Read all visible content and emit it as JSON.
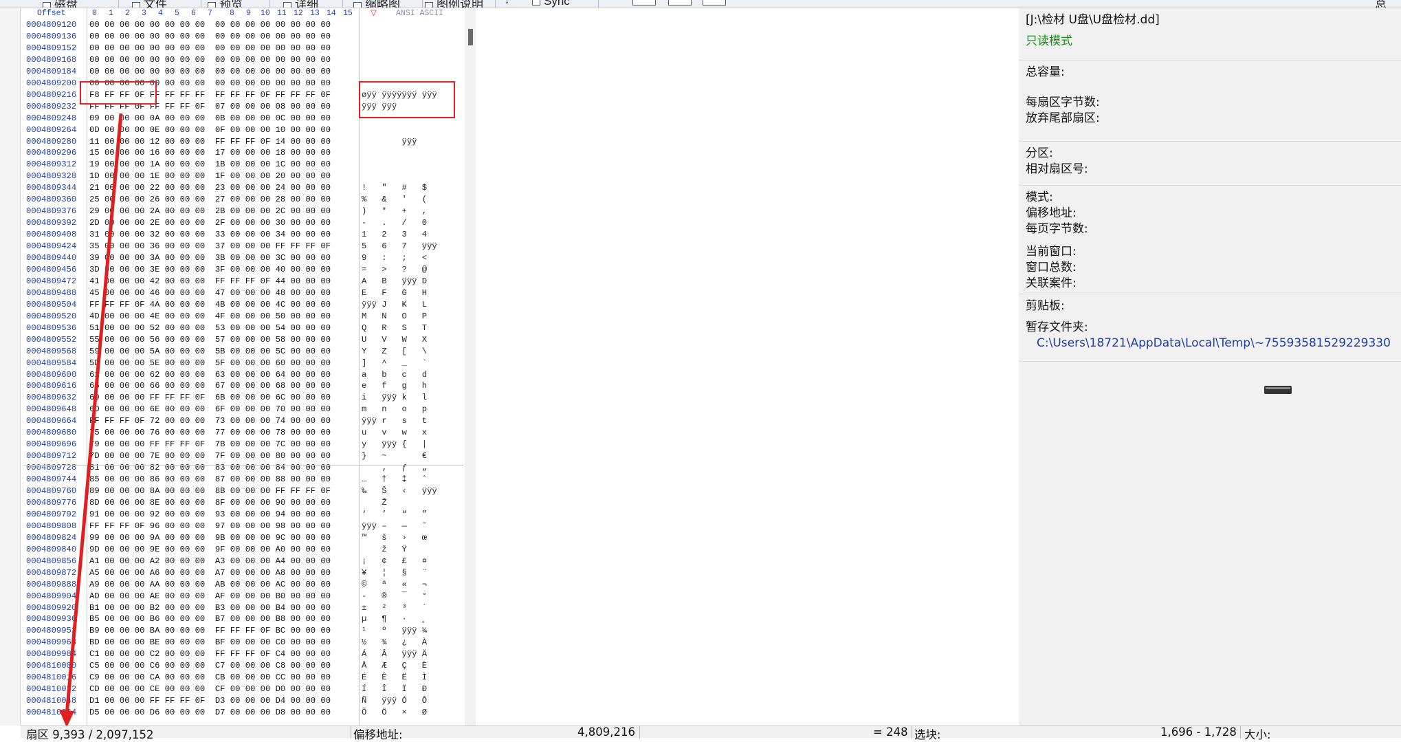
{
  "toolbar": {
    "items": [
      {
        "label": "磁盘",
        "icon": "disk-icon"
      },
      {
        "label": "文件",
        "icon": "file-icon"
      },
      {
        "label": "预览",
        "icon": "preview-icon"
      },
      {
        "label": "详细",
        "icon": "details-icon"
      },
      {
        "label": "缩略图",
        "icon": "thumbnail-icon"
      },
      {
        "label": "图例说明",
        "icon": "legend-icon"
      },
      {
        "label": "Sync",
        "icon": "sync-icon"
      }
    ],
    "right_label": "总"
  },
  "hex_view": {
    "header": {
      "offset_label": "Offset",
      "columns": [
        "0",
        "1",
        "2",
        "3",
        "4",
        "5",
        "6",
        "7",
        "8",
        "9",
        "10",
        "11",
        "12",
        "13",
        "14",
        "15"
      ],
      "ascii_label": "ANSI ASCII"
    },
    "rows": [
      {
        "off": "0004809120",
        "bytes": "00 00 00 00 00 00 00 00  00 00 00 00 00 00 00 00",
        "ascii": ""
      },
      {
        "off": "0004809136",
        "bytes": "00 00 00 00 00 00 00 00  00 00 00 00 00 00 00 00",
        "ascii": ""
      },
      {
        "off": "0004809152",
        "bytes": "00 00 00 00 00 00 00 00  00 00 00 00 00 00 00 00",
        "ascii": ""
      },
      {
        "off": "0004809168",
        "bytes": "00 00 00 00 00 00 00 00  00 00 00 00 00 00 00 00",
        "ascii": ""
      },
      {
        "off": "0004809184",
        "bytes": "00 00 00 00 00 00 00 00  00 00 00 00 00 00 00 00",
        "ascii": ""
      },
      {
        "off": "0004809200",
        "bytes": "00 00 00 00 00 00 00 00  00 00 00 00 00 00 00 00",
        "ascii": ""
      },
      {
        "off": "0004809216",
        "bytes": "F8 FF FF 0F FF FF FF FF  FF FF FF 0F FF FF FF 0F",
        "ascii": "øÿÿ ÿÿÿÿÿÿÿ ÿÿÿ"
      },
      {
        "off": "0004809232",
        "bytes": "FF FF FF 0F FF FF FF 0F  07 00 00 00 08 00 00 00",
        "ascii": "ÿÿÿ ÿÿÿ"
      },
      {
        "off": "0004809248",
        "bytes": "09 00 00 00 0A 00 00 00  0B 00 00 00 0C 00 00 00",
        "ascii": ""
      },
      {
        "off": "0004809264",
        "bytes": "0D 00 00 00 0E 00 00 00  0F 00 00 00 10 00 00 00",
        "ascii": ""
      },
      {
        "off": "0004809280",
        "bytes": "11 00 00 00 12 00 00 00  FF FF FF 0F 14 00 00 00",
        "ascii": "        ÿÿÿ"
      },
      {
        "off": "0004809296",
        "bytes": "15 00 00 00 16 00 00 00  17 00 00 00 18 00 00 00",
        "ascii": ""
      },
      {
        "off": "0004809312",
        "bytes": "19 00 00 00 1A 00 00 00  1B 00 00 00 1C 00 00 00",
        "ascii": ""
      },
      {
        "off": "0004809328",
        "bytes": "1D 00 00 00 1E 00 00 00  1F 00 00 00 20 00 00 00",
        "ascii": ""
      },
      {
        "off": "0004809344",
        "bytes": "21 00 00 00 22 00 00 00  23 00 00 00 24 00 00 00",
        "ascii": "!   \"   #   $"
      },
      {
        "off": "0004809360",
        "bytes": "25 00 00 00 26 00 00 00  27 00 00 00 28 00 00 00",
        "ascii": "%   &   '   ("
      },
      {
        "off": "0004809376",
        "bytes": "29 00 00 00 2A 00 00 00  2B 00 00 00 2C 00 00 00",
        "ascii": ")   *   +   ,"
      },
      {
        "off": "0004809392",
        "bytes": "2D 00 00 00 2E 00 00 00  2F 00 00 00 30 00 00 00",
        "ascii": "-   .   /   0"
      },
      {
        "off": "0004809408",
        "bytes": "31 00 00 00 32 00 00 00  33 00 00 00 34 00 00 00",
        "ascii": "1   2   3   4"
      },
      {
        "off": "0004809424",
        "bytes": "35 00 00 00 36 00 00 00  37 00 00 00 FF FF FF 0F",
        "ascii": "5   6   7   ÿÿÿ"
      },
      {
        "off": "0004809440",
        "bytes": "39 00 00 00 3A 00 00 00  3B 00 00 00 3C 00 00 00",
        "ascii": "9   :   ;   <"
      },
      {
        "off": "0004809456",
        "bytes": "3D 00 00 00 3E 00 00 00  3F 00 00 00 40 00 00 00",
        "ascii": "=   >   ?   @"
      },
      {
        "off": "0004809472",
        "bytes": "41 00 00 00 42 00 00 00  FF FF FF 0F 44 00 00 00",
        "ascii": "A   B   ÿÿÿ D"
      },
      {
        "off": "0004809488",
        "bytes": "45 00 00 00 46 00 00 00  47 00 00 00 48 00 00 00",
        "ascii": "E   F   G   H"
      },
      {
        "off": "0004809504",
        "bytes": "FF FF FF 0F 4A 00 00 00  4B 00 00 00 4C 00 00 00",
        "ascii": "ÿÿÿ J   K   L"
      },
      {
        "off": "0004809520",
        "bytes": "4D 00 00 00 4E 00 00 00  4F 00 00 00 50 00 00 00",
        "ascii": "M   N   O   P"
      },
      {
        "off": "0004809536",
        "bytes": "51 00 00 00 52 00 00 00  53 00 00 00 54 00 00 00",
        "ascii": "Q   R   S   T"
      },
      {
        "off": "0004809552",
        "bytes": "55 00 00 00 56 00 00 00  57 00 00 00 58 00 00 00",
        "ascii": "U   V   W   X"
      },
      {
        "off": "0004809568",
        "bytes": "59 00 00 00 5A 00 00 00  5B 00 00 00 5C 00 00 00",
        "ascii": "Y   Z   [   \\"
      },
      {
        "off": "0004809584",
        "bytes": "5D 00 00 00 5E 00 00 00  5F 00 00 00 60 00 00 00",
        "ascii": "]   ^   _   `"
      },
      {
        "off": "0004809600",
        "bytes": "61 00 00 00 62 00 00 00  63 00 00 00 64 00 00 00",
        "ascii": "a   b   c   d"
      },
      {
        "off": "0004809616",
        "bytes": "65 00 00 00 66 00 00 00  67 00 00 00 68 00 00 00",
        "ascii": "e   f   g   h"
      },
      {
        "off": "0004809632",
        "bytes": "69 00 00 00 FF FF FF 0F  6B 00 00 00 6C 00 00 00",
        "ascii": "i   ÿÿÿ k   l"
      },
      {
        "off": "0004809648",
        "bytes": "6D 00 00 00 6E 00 00 00  6F 00 00 00 70 00 00 00",
        "ascii": "m   n   o   p"
      },
      {
        "off": "0004809664",
        "bytes": "FF FF FF 0F 72 00 00 00  73 00 00 00 74 00 00 00",
        "ascii": "ÿÿÿ r   s   t"
      },
      {
        "off": "0004809680",
        "bytes": "75 00 00 00 76 00 00 00  77 00 00 00 78 00 00 00",
        "ascii": "u   v   w   x"
      },
      {
        "off": "0004809696",
        "bytes": "79 00 00 00 FF FF FF 0F  7B 00 00 00 7C 00 00 00",
        "ascii": "y   ÿÿÿ {   |"
      },
      {
        "off": "0004809712",
        "bytes": "7D 00 00 00 7E 00 00 00  7F 00 00 00 80 00 00 00",
        "ascii": "}   ~       €"
      },
      {
        "off": "0004809728",
        "bytes": "81 00 00 00 82 00 00 00  83 00 00 00 84 00 00 00",
        "ascii": "    ‚   ƒ   „"
      },
      {
        "off": "0004809744",
        "bytes": "85 00 00 00 86 00 00 00  87 00 00 00 88 00 00 00",
        "ascii": "…   †   ‡   ˆ"
      },
      {
        "off": "0004809760",
        "bytes": "89 00 00 00 8A 00 00 00  8B 00 00 00 FF FF FF 0F",
        "ascii": "‰   Š   ‹   ÿÿÿ"
      },
      {
        "off": "0004809776",
        "bytes": "8D 00 00 00 8E 00 00 00  8F 00 00 00 90 00 00 00",
        "ascii": "    Ž"
      },
      {
        "off": "0004809792",
        "bytes": "91 00 00 00 92 00 00 00  93 00 00 00 94 00 00 00",
        "ascii": "‘   ’   “   ”"
      },
      {
        "off": "0004809808",
        "bytes": "FF FF FF 0F 96 00 00 00  97 00 00 00 98 00 00 00",
        "ascii": "ÿÿÿ –   —   ˜"
      },
      {
        "off": "0004809824",
        "bytes": "99 00 00 00 9A 00 00 00  9B 00 00 00 9C 00 00 00",
        "ascii": "™   š   ›   œ"
      },
      {
        "off": "0004809840",
        "bytes": "9D 00 00 00 9E 00 00 00  9F 00 00 00 A0 00 00 00",
        "ascii": "    ž   Ÿ"
      },
      {
        "off": "0004809856",
        "bytes": "A1 00 00 00 A2 00 00 00  A3 00 00 00 A4 00 00 00",
        "ascii": "¡   ¢   £   ¤"
      },
      {
        "off": "0004809872",
        "bytes": "A5 00 00 00 A6 00 00 00  A7 00 00 00 A8 00 00 00",
        "ascii": "¥   ¦   §   ¨"
      },
      {
        "off": "0004809888",
        "bytes": "A9 00 00 00 AA 00 00 00  AB 00 00 00 AC 00 00 00",
        "ascii": "©   ª   «   ¬"
      },
      {
        "off": "0004809904",
        "bytes": "AD 00 00 00 AE 00 00 00  AF 00 00 00 B0 00 00 00",
        "ascii": "-   ®   ¯   °"
      },
      {
        "off": "0004809920",
        "bytes": "B1 00 00 00 B2 00 00 00  B3 00 00 00 B4 00 00 00",
        "ascii": "±   ²   ³   ´"
      },
      {
        "off": "0004809936",
        "bytes": "B5 00 00 00 B6 00 00 00  B7 00 00 00 B8 00 00 00",
        "ascii": "µ   ¶   ·   ¸"
      },
      {
        "off": "0004809952",
        "bytes": "B9 00 00 00 BA 00 00 00  FF FF FF 0F BC 00 00 00",
        "ascii": "¹   º   ÿÿÿ ¼"
      },
      {
        "off": "0004809968",
        "bytes": "BD 00 00 00 BE 00 00 00  BF 00 00 00 C0 00 00 00",
        "ascii": "½   ¾   ¿   À"
      },
      {
        "off": "0004809984",
        "bytes": "C1 00 00 00 C2 00 00 00  FF FF FF 0F C4 00 00 00",
        "ascii": "Á   Â   ÿÿÿ Ä"
      },
      {
        "off": "0004810000",
        "bytes": "C5 00 00 00 C6 00 00 00  C7 00 00 00 C8 00 00 00",
        "ascii": "Å   Æ   Ç   È"
      },
      {
        "off": "0004810016",
        "bytes": "C9 00 00 00 CA 00 00 00  CB 00 00 00 CC 00 00 00",
        "ascii": "É   Ê   Ë   Ì"
      },
      {
        "off": "0004810032",
        "bytes": "CD 00 00 00 CE 00 00 00  CF 00 00 00 D0 00 00 00",
        "ascii": "Í   Î   Ï   Ð"
      },
      {
        "off": "0004810048",
        "bytes": "D1 00 00 00 FF FF FF 0F  D3 00 00 00 D4 00 00 00",
        "ascii": "Ñ   ÿÿÿ Ó   Ô"
      },
      {
        "off": "0004810064",
        "bytes": "D5 00 00 00 D6 00 00 00  D7 00 00 00 D8 00 00 00",
        "ascii": "Õ   Ö   ×   Ø"
      }
    ]
  },
  "info_panel": {
    "path": "[J:\\检材 U盘\\U盘检材.dd]",
    "mode": "只读模式",
    "total_capacity": "总容量:",
    "bytes_per_sector": "每扇区字节数:",
    "discard_tail": "放弃尾部扇区:",
    "partition": "分区:",
    "relative_sector": "相对扇区号:",
    "mode_label": "模式:",
    "offset_label": "偏移地址:",
    "bytes_per_page": "每页字节数:",
    "current_window": "当前窗口:",
    "window_total": "窗口总数:",
    "related_case": "关联案件:",
    "clipboard": "剪贴板:",
    "temp_folder_label": "暂存文件夹:",
    "temp_folder_path": "C:\\Users\\18721\\AppData\\Local\\Temp\\~75593581529229330"
  },
  "status_bar": {
    "sector": "扇区 9,393 / 2,097,152",
    "offset_label": "偏移地址:",
    "offset_value": "4,809,216",
    "equals": "= 248",
    "block_label": "选块:",
    "block_value": "1,696 - 1,728",
    "size_label": "大小:"
  },
  "colors": {
    "annotation": "#e02020",
    "offset_blue": "#1f3fa6",
    "mode_green": "#139013"
  }
}
